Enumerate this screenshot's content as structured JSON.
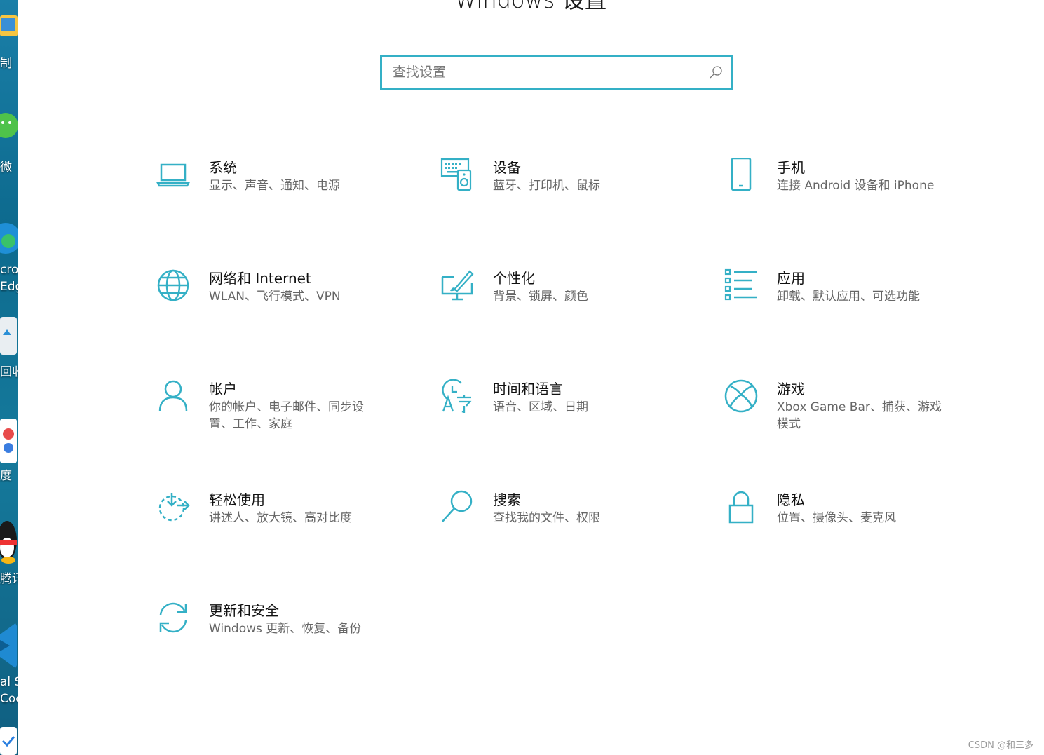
{
  "window": {
    "title": "Windows 设置"
  },
  "search": {
    "placeholder": "查找设置"
  },
  "accent_color": "#34b0c6",
  "desktop_labels": [
    "制",
    "微",
    "cro",
    "Edg",
    "回收",
    "度",
    "腾讯",
    "al S",
    "Coc"
  ],
  "tiles": [
    {
      "title": "系统",
      "desc": "显示、声音、通知、电源",
      "icon": "laptop-icon"
    },
    {
      "title": "设备",
      "desc": "蓝牙、打印机、鼠标",
      "icon": "devices-icon"
    },
    {
      "title": "手机",
      "desc": "连接 Android 设备和 iPhone",
      "icon": "phone-icon"
    },
    {
      "title": "网络和 Internet",
      "desc": "WLAN、飞行模式、VPN",
      "icon": "globe-icon"
    },
    {
      "title": "个性化",
      "desc": "背景、锁屏、颜色",
      "icon": "personalization-icon"
    },
    {
      "title": "应用",
      "desc": "卸载、默认应用、可选功能",
      "icon": "apps-list-icon"
    },
    {
      "title": "帐户",
      "desc": "你的帐户、电子邮件、同步设置、工作、家庭",
      "icon": "person-icon"
    },
    {
      "title": "时间和语言",
      "desc": "语音、区域、日期",
      "icon": "time-language-icon"
    },
    {
      "title": "游戏",
      "desc": "Xbox Game Bar、捕获、游戏模式",
      "icon": "xbox-icon"
    },
    {
      "title": "轻松使用",
      "desc": "讲述人、放大镜、高对比度",
      "icon": "ease-of-access-icon"
    },
    {
      "title": "搜索",
      "desc": "查找我的文件、权限",
      "icon": "search-magnifier-icon"
    },
    {
      "title": "隐私",
      "desc": "位置、摄像头、麦克风",
      "icon": "lock-icon"
    },
    {
      "title": "更新和安全",
      "desc": "Windows 更新、恢复、备份",
      "icon": "update-sync-icon"
    }
  ],
  "watermark": "CSDN @和三多"
}
